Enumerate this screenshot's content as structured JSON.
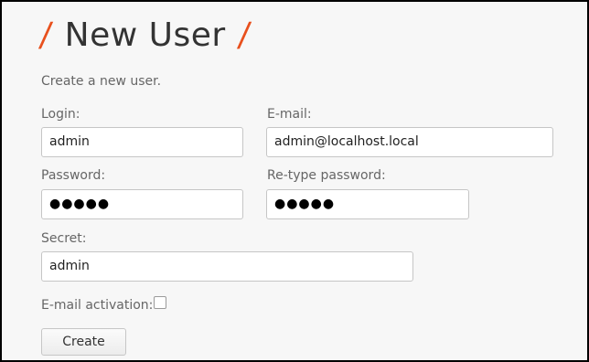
{
  "header": {
    "title": "New User",
    "slash": "/",
    "accent_color": "#e8501d"
  },
  "intro_text": "Create a new user.",
  "form": {
    "login": {
      "label": "Login:",
      "value": "admin"
    },
    "email": {
      "label": "E-mail:",
      "value": "admin@localhost.local"
    },
    "password": {
      "label": "Password:",
      "value_masked": "●●●●●"
    },
    "retype_password": {
      "label": "Re-type password:",
      "value_masked": "●●●●●"
    },
    "secret": {
      "label": "Secret:",
      "value": "admin"
    },
    "email_activation": {
      "label": "E-mail activation:",
      "checked": false
    },
    "create_button_label": "Create"
  }
}
